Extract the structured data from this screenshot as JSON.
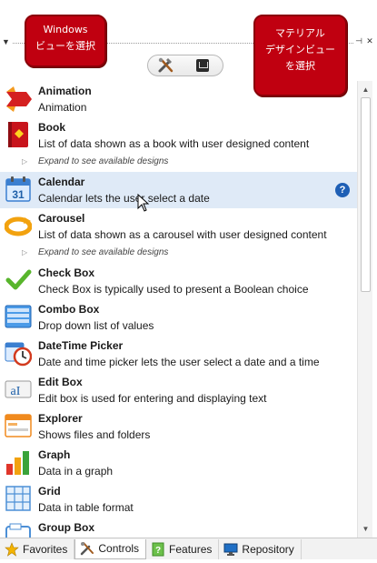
{
  "callouts": {
    "windows_view": [
      "Windows",
      "ビューを選択"
    ],
    "material_view": [
      "マテリアル",
      "デザインビュー",
      "を選択"
    ]
  },
  "list": {
    "expand_text": "Expand to see available designs",
    "items": [
      {
        "title": "Animation",
        "desc": "Animation",
        "icon": "animation-icon"
      },
      {
        "title": "Book",
        "desc": "List of data shown as a book with user designed content",
        "icon": "book-icon"
      },
      {
        "title": "Calendar",
        "desc": "Calendar lets the user select a date",
        "icon": "calendar-icon",
        "calendar_day": "31"
      },
      {
        "title": "Carousel",
        "desc": "List of data shown as a carousel with user designed content",
        "icon": "carousel-icon"
      },
      {
        "title": "Check Box",
        "desc": "Check Box is typically used to present a Boolean choice",
        "icon": "check-box-icon"
      },
      {
        "title": "Combo Box",
        "desc": "Drop down list of values",
        "icon": "combo-box-icon"
      },
      {
        "title": "DateTime Picker",
        "desc": "Date and time picker lets the user select a date and a time",
        "icon": "datetime-picker-icon"
      },
      {
        "title": "Edit Box",
        "desc": "Edit box is used for entering and displaying text",
        "icon": "edit-box-icon",
        "icon_text": "aI"
      },
      {
        "title": "Explorer",
        "desc": "Shows files and folders",
        "icon": "explorer-icon"
      },
      {
        "title": "Graph",
        "desc": "Data in a graph",
        "icon": "graph-icon"
      },
      {
        "title": "Grid",
        "desc": "Data in table format",
        "icon": "grid-icon"
      },
      {
        "title": "Group Box",
        "desc": "",
        "icon": "group-box-icon"
      }
    ],
    "help_label": "?"
  },
  "tabs": [
    {
      "label": "Favorites",
      "icon": "star-icon"
    },
    {
      "label": "Controls",
      "icon": "tools-icon"
    },
    {
      "label": "Features",
      "icon": "features-icon"
    },
    {
      "label": "Repository",
      "icon": "repository-icon"
    }
  ],
  "colors": {
    "callout": "#c00010",
    "selected_row": "#dfeaf7",
    "help": "#1e5fb5"
  }
}
